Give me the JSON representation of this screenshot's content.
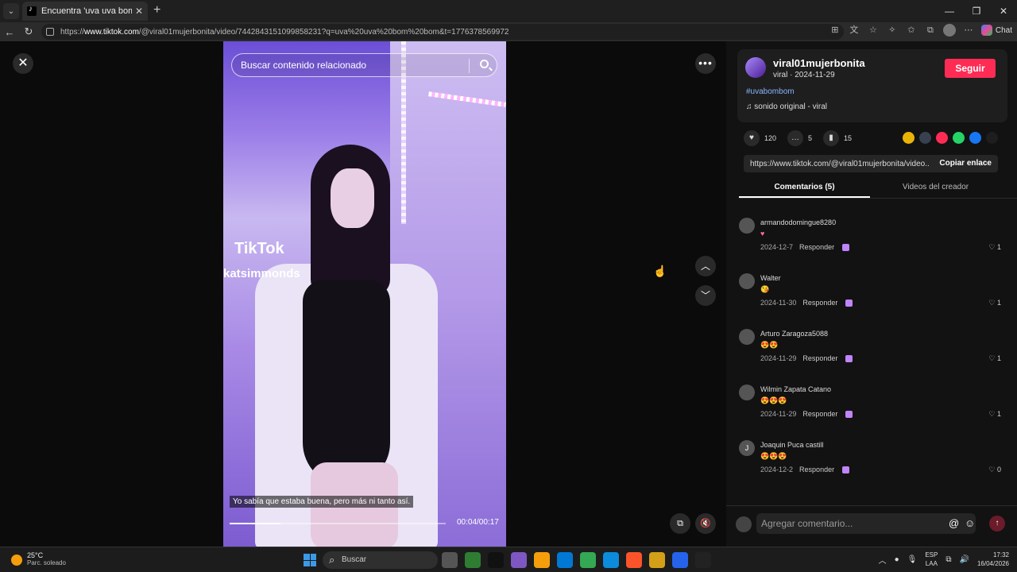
{
  "browser": {
    "tab_title": "Encuentra 'uva uva bom bom' en",
    "url_prefix": "https://",
    "url_host": "www.tiktok.com",
    "url_path": "/@viral01mujerbonita/video/7442843151099858231?q=uva%20uva%20bom%20bom&t=1776378569972",
    "chat_label": "Chat"
  },
  "video": {
    "search_placeholder": "Buscar contenido relacionado",
    "watermark_logo": "TikTok",
    "watermark_user": "katsimmonds",
    "subtitle": "Yo sabía que estaba buena, pero más ni tanto así.",
    "timecode": "00:04/00:17",
    "progress": 0.235
  },
  "post": {
    "username": "viral01mujerbonita",
    "meta": "viral · 2024-11-29",
    "follow_label": "Seguir",
    "hashtag": "#uvabombom",
    "sound": "sonido original - viral",
    "likes": "120",
    "comments_count": "5",
    "saves": "15",
    "link_text": "https://www.tiktok.com/@viral01mujerbonita/video...",
    "copy_label": "Copiar enlace",
    "share_icons": [
      {
        "name": "embed-coin",
        "color": "#eab308"
      },
      {
        "name": "embed-code",
        "color": "#374151"
      },
      {
        "name": "send-to-friend",
        "color": "#fe2c55"
      },
      {
        "name": "whatsapp",
        "color": "#25d366"
      },
      {
        "name": "facebook",
        "color": "#1877f2"
      },
      {
        "name": "share-arrow",
        "color": "#1e1e1e"
      }
    ]
  },
  "tabs": {
    "comments": "Comentarios (5)",
    "creator_videos": "Videos del creador"
  },
  "comments": [
    {
      "name": "armandodomingue8280",
      "text": "♥",
      "date": "2024-12-7",
      "reply": "Responder",
      "likes": "1",
      "avatar": ""
    },
    {
      "name": "Walter",
      "text": "😘",
      "date": "2024-11-30",
      "reply": "Responder",
      "likes": "1",
      "avatar": ""
    },
    {
      "name": "Arturo Zaragoza5088",
      "text": "😍😍",
      "date": "2024-11-29",
      "reply": "Responder",
      "likes": "1",
      "avatar": ""
    },
    {
      "name": "Wilmin Zapata Catano",
      "text": "😍😍😍",
      "date": "2024-11-29",
      "reply": "Responder",
      "likes": "1",
      "avatar": ""
    },
    {
      "name": "Joaquin Puca castill",
      "text": "😍😍😍",
      "date": "2024-12-2",
      "reply": "Responder",
      "likes": "0",
      "avatar": "J"
    }
  ],
  "composer": {
    "placeholder": "Agregar comentario..."
  },
  "taskbar": {
    "temp": "25°C",
    "weather": "Parc. soleado",
    "search": "Buscar",
    "lang1": "ESP",
    "lang2": "LAA",
    "time": "17:32",
    "date": "16/04/2026",
    "app_colors": [
      "#555555",
      "#2e7d32",
      "#111111",
      "#7e57c2",
      "#f59e0b",
      "#0078d4",
      "#34a853",
      "#0c8cdc",
      "#fb542b",
      "#d4a017",
      "#2563eb",
      "#222222"
    ]
  }
}
